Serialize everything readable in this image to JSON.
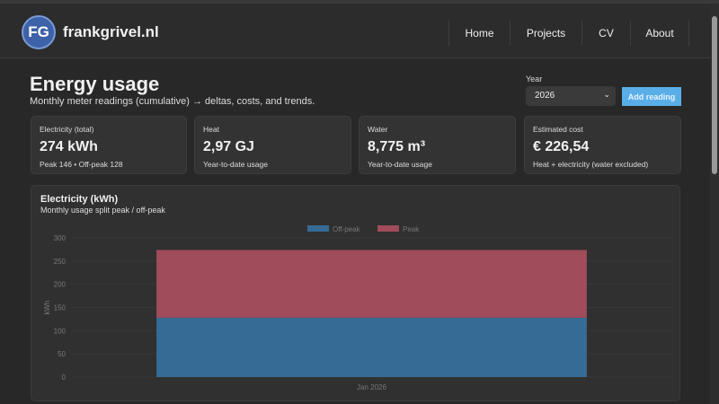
{
  "header": {
    "logo": "FG",
    "site": "frankgrivel.nl",
    "nav": [
      "Home",
      "Projects",
      "CV",
      "About"
    ]
  },
  "page": {
    "title": "Energy usage",
    "subtitle": "Monthly meter readings (cumulative) → deltas, costs, and trends.",
    "year_label": "Year",
    "year_value": "2026",
    "add_label": "Add reading"
  },
  "cards": [
    {
      "label": "Electricity (total)",
      "value": "274 kWh",
      "sub": "Peak 146 • Off-peak 128"
    },
    {
      "label": "Heat",
      "value": "2,97 GJ",
      "sub": "Year-to-date usage"
    },
    {
      "label": "Water",
      "value": "8,775 m³",
      "sub": "Year-to-date usage"
    },
    {
      "label": "Estimated cost",
      "value": "€ 226,54",
      "sub": "Heat + electricity (water excluded)"
    }
  ],
  "chart_panel": {
    "title": "Electricity (kWh)",
    "subtitle": "Monthly usage split peak / off-peak"
  },
  "chart_data": {
    "type": "bar",
    "stacked": true,
    "categories": [
      "Jan 2026"
    ],
    "series": [
      {
        "name": "Off-peak",
        "values": [
          128
        ],
        "color": "#356b94"
      },
      {
        "name": "Peak",
        "values": [
          146
        ],
        "color": "#a04c5b"
      }
    ],
    "ylabel": "kWh",
    "ylim": [
      0,
      300
    ],
    "yticks": [
      0,
      50,
      100,
      150,
      200,
      250,
      300
    ],
    "legend": "top"
  }
}
